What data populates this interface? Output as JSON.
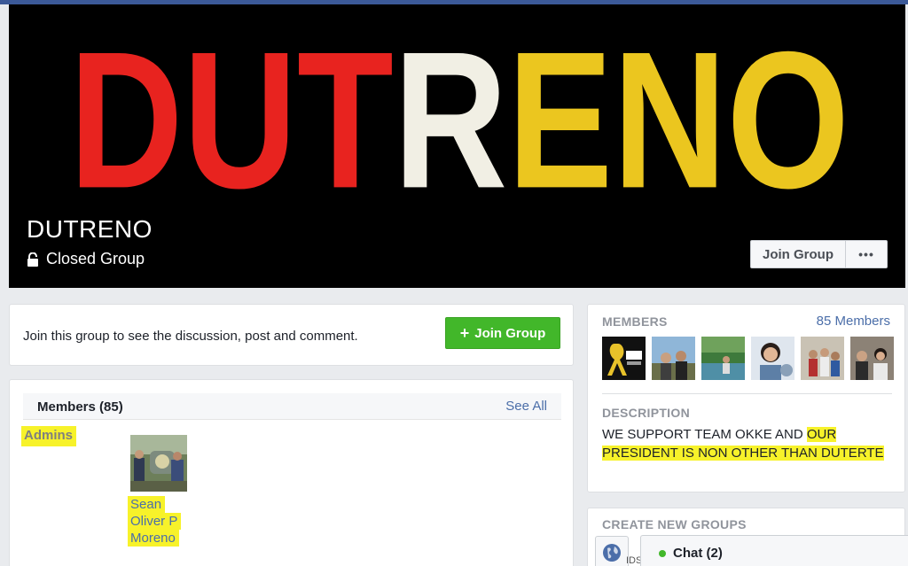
{
  "cover": {
    "logo_text": {
      "part1": "DUT",
      "part2": "R",
      "part3": "ENO"
    },
    "group_name": "DUTRENO",
    "privacy": "Closed Group",
    "join_button": "Join Group",
    "more_button": "•••",
    "colors": {
      "red": "#e8231f",
      "white": "#f1efe4",
      "yellow": "#ebc61f"
    }
  },
  "join_card": {
    "message": "Join this group to see the discussion, post and comment.",
    "button_label": "Join Group",
    "button_icon": "+"
  },
  "members_card": {
    "title": "Members (85)",
    "see_all": "See All",
    "admins_label": "Admins",
    "admin": {
      "name_lines": [
        "Sean",
        "Oliver P",
        "Moreno"
      ]
    }
  },
  "sidebar": {
    "members_label": "MEMBERS",
    "members_count": "85 Members",
    "description_label": "DESCRIPTION",
    "description": {
      "plain": "WE SUPPORT TEAM OKKE AND ",
      "highlighted": "OUR PRESIDENT IS NON OTHER THAN DUTERTE"
    },
    "create_groups_label": "CREATE NEW GROUPS"
  },
  "chat": {
    "label": "Chat (2)",
    "edge_text": "IDS"
  },
  "highlight_color": "#f7f22a"
}
